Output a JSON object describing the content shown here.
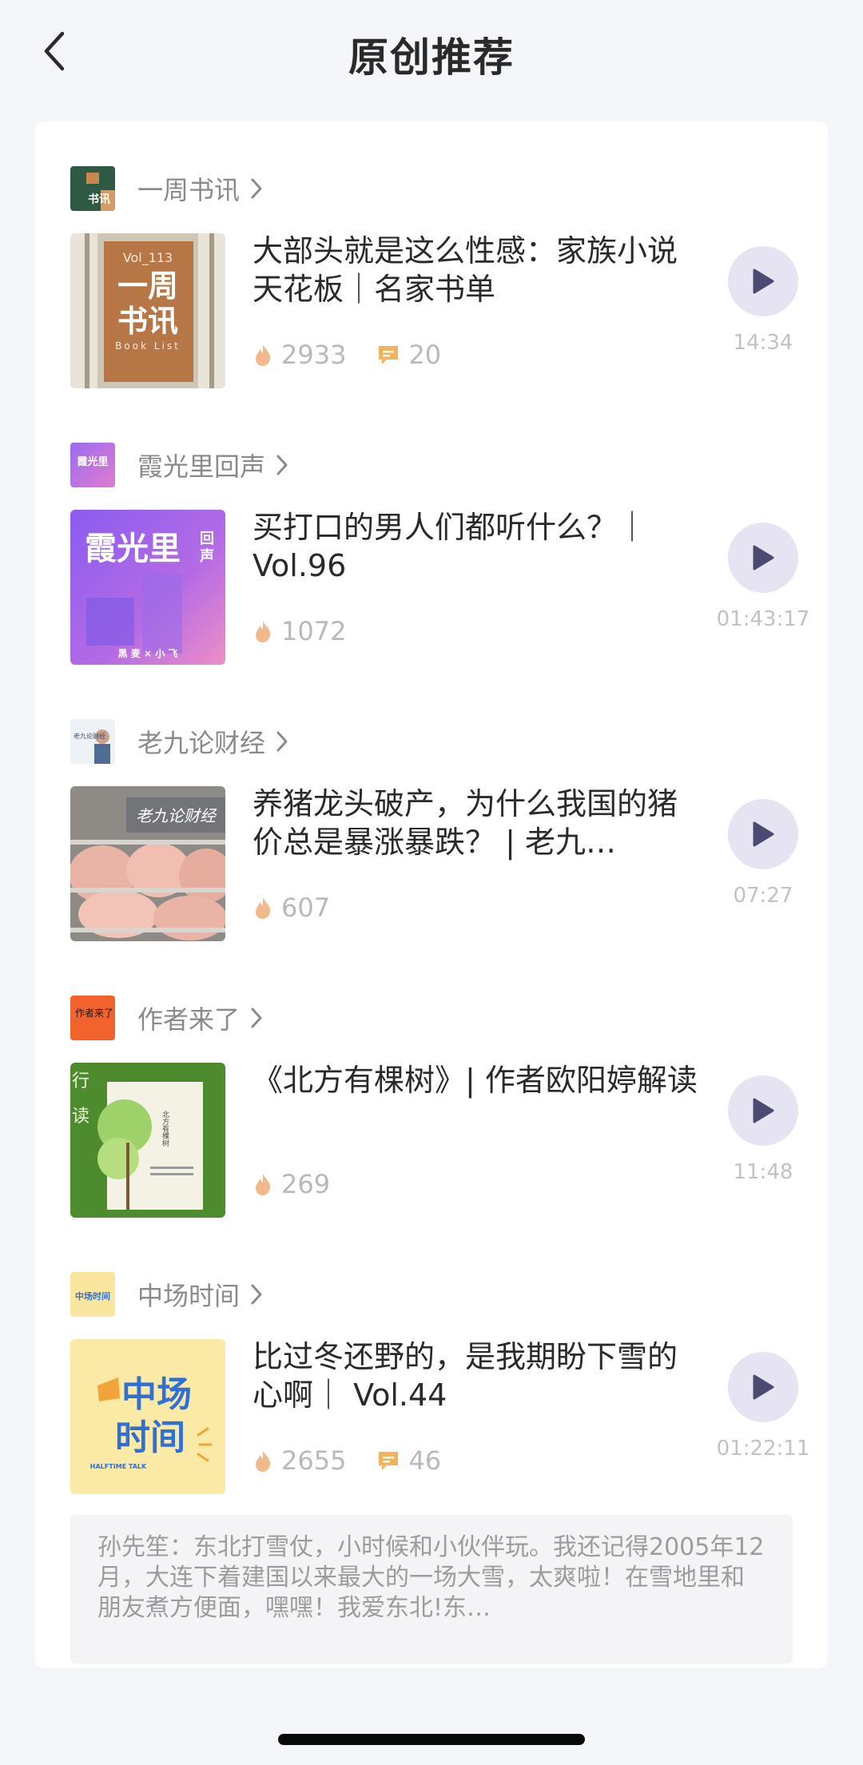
{
  "header": {
    "title": "原创推荐"
  },
  "items": [
    {
      "source": "一周书讯",
      "title": "大部头就是这么性感：家族小说天花板｜名家书单",
      "plays": "2933",
      "comments": "20",
      "duration": "14:34",
      "cover_text": {
        "vol": "Vol_113",
        "main": "一周书讯",
        "sub": "Book List"
      },
      "logo_text": "书讯"
    },
    {
      "source": "霞光里回声",
      "title": "买打口的男人们都听什么？｜Vol.96",
      "plays": "1072",
      "duration": "01:43:17",
      "cover_text": {
        "main": "霞光里",
        "side": "回声",
        "sub": "黑 麦 × 小 飞"
      },
      "logo_text": "霞光里"
    },
    {
      "source": "老九论财经",
      "title": "养猪龙头破产，为什么我国的猪价总是暴涨暴跌？ | 老九…",
      "plays": "607",
      "duration": "07:27",
      "cover_text": {
        "main": "老九论财经"
      },
      "logo_text": "老九论财经"
    },
    {
      "source": "作者来了",
      "title": "《北方有棵树》| 作者欧阳婷解读",
      "plays": "269",
      "duration": "11:48",
      "cover_text": {
        "side": "行读",
        "book": "北方有棵树"
      },
      "logo_text": "作者来了"
    },
    {
      "source": "中场时间",
      "title": "比过冬还野的，是我期盼下雪的心啊｜ Vol.44",
      "plays": "2655",
      "comments": "46",
      "duration": "01:22:11",
      "cover_text": {
        "main1": "中场",
        "main2": "时间",
        "sub": "HALFTIME TALK"
      },
      "logo_text": "中场时间"
    }
  ],
  "comment": {
    "text": "孙先笙：东北打雪仗，小时候和小伙伴玩。我还记得2005年12月，大连下着建国以来最大的一场大雪，太爽啦！在雪地里和朋友煮方便面，嘿嘿！我爱东北!东…"
  },
  "colors": {
    "accent": "#e6e4f3",
    "play_icon": "#4a4a72",
    "flame": "#f2b98a",
    "bubble": "#f4b35a"
  }
}
